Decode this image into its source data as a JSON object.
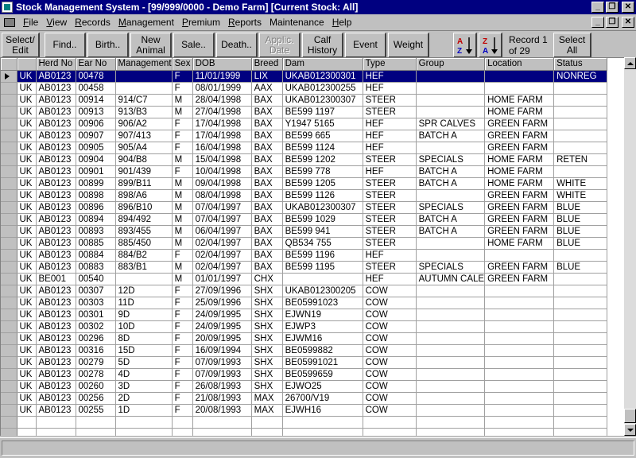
{
  "window": {
    "title": "Stock Management System - [99/999/0000 - Demo Farm] [Current Stock: All]"
  },
  "menu": [
    {
      "key": "F",
      "rest": "ile"
    },
    {
      "key": "V",
      "rest": "iew"
    },
    {
      "key": "R",
      "rest": "ecords"
    },
    {
      "key": "M",
      "rest": "anagement"
    },
    {
      "key": "P",
      "rest": "remium"
    },
    {
      "key": "R",
      "rest": "eports"
    },
    {
      "key": "",
      "rest": "Maintenance"
    },
    {
      "key": "H",
      "rest": "elp"
    }
  ],
  "toolbar": {
    "select_edit": "Select/\nEdit",
    "find": "Find..",
    "birth": "Birth..",
    "new_animal": "New\nAnimal",
    "sale": "Sale..",
    "death": "Death..",
    "applic_date": "Applic.\nDate",
    "calf_history": "Calf\nHistory",
    "event": "Event",
    "weight": "Weight",
    "record_info": "Record 1\nof 29",
    "select_all": "Select\nAll"
  },
  "grid": {
    "columns": [
      "",
      "Herd No",
      "Ear No",
      "Management",
      "Sex",
      "DOB",
      "Breed",
      "Dam",
      "Type",
      "Group",
      "Location",
      "Status"
    ],
    "rows": [
      [
        "UK",
        "AB0123",
        "00478",
        "",
        "F",
        "11/01/1999",
        "LIX",
        "UKAB012300301",
        "HEF",
        "",
        "",
        "NONREG"
      ],
      [
        "UK",
        "AB0123",
        "00458",
        "",
        "F",
        "08/01/1999",
        "AAX",
        "UKAB012300255",
        "HEF",
        "",
        "",
        ""
      ],
      [
        "UK",
        "AB0123",
        "00914",
        "914/C7",
        "M",
        "28/04/1998",
        "BAX",
        "UKAB012300307",
        "STEER",
        "",
        "HOME FARM",
        ""
      ],
      [
        "UK",
        "AB0123",
        "00913",
        "913/B3",
        "M",
        "27/04/1998",
        "BAX",
        "BE599 1197",
        "STEER",
        "",
        "HOME FARM",
        ""
      ],
      [
        "UK",
        "AB0123",
        "00906",
        "906/A2",
        "F",
        "17/04/1998",
        "BAX",
        "Y1947 5165",
        "HEF",
        "SPR CALVES",
        "GREEN FARM",
        ""
      ],
      [
        "UK",
        "AB0123",
        "00907",
        "907/413",
        "F",
        "17/04/1998",
        "BAX",
        "BE599 665",
        "HEF",
        "BATCH A",
        "GREEN FARM",
        ""
      ],
      [
        "UK",
        "AB0123",
        "00905",
        "905/A4",
        "F",
        "16/04/1998",
        "BAX",
        "BE599 1124",
        "HEF",
        "",
        "GREEN FARM",
        ""
      ],
      [
        "UK",
        "AB0123",
        "00904",
        "904/B8",
        "M",
        "15/04/1998",
        "BAX",
        "BE599 1202",
        "STEER",
        "SPECIALS",
        "HOME FARM",
        "RETEN"
      ],
      [
        "UK",
        "AB0123",
        "00901",
        "901/439",
        "F",
        "10/04/1998",
        "BAX",
        "BE599 778",
        "HEF",
        "BATCH A",
        "HOME FARM",
        ""
      ],
      [
        "UK",
        "AB0123",
        "00899",
        "899/B11",
        "M",
        "09/04/1998",
        "BAX",
        "BE599 1205",
        "STEER",
        "BATCH A",
        "HOME FARM",
        "WHITE"
      ],
      [
        "UK",
        "AB0123",
        "00898",
        "898/A6",
        "M",
        "08/04/1998",
        "BAX",
        "BE599 1126",
        "STEER",
        "",
        "GREEN FARM",
        "WHITE"
      ],
      [
        "UK",
        "AB0123",
        "00896",
        "896/B10",
        "M",
        "07/04/1997",
        "BAX",
        "UKAB012300307",
        "STEER",
        "SPECIALS",
        "GREEN FARM",
        "BLUE"
      ],
      [
        "UK",
        "AB0123",
        "00894",
        "894/492",
        "M",
        "07/04/1997",
        "BAX",
        "BE599 1029",
        "STEER",
        "BATCH A",
        "GREEN FARM",
        "BLUE"
      ],
      [
        "UK",
        "AB0123",
        "00893",
        "893/455",
        "M",
        "06/04/1997",
        "BAX",
        "BE599 941",
        "STEER",
        "BATCH A",
        "GREEN FARM",
        "BLUE"
      ],
      [
        "UK",
        "AB0123",
        "00885",
        "885/450",
        "M",
        "02/04/1997",
        "BAX",
        "QB534 755",
        "STEER",
        "",
        "HOME FARM",
        "BLUE"
      ],
      [
        "UK",
        "AB0123",
        "00884",
        "884/B2",
        "F",
        "02/04/1997",
        "BAX",
        "BE599 1196",
        "HEF",
        "",
        "",
        ""
      ],
      [
        "UK",
        "AB0123",
        "00883",
        "883/B1",
        "M",
        "02/04/1997",
        "BAX",
        "BE599 1195",
        "STEER",
        "SPECIALS",
        "GREEN FARM",
        "BLUE"
      ],
      [
        "UK",
        "BE001",
        "00540",
        "",
        "M",
        "01/01/1997",
        "CHX",
        "",
        "HEF",
        "AUTUMN CALE",
        "GREEN FARM",
        ""
      ],
      [
        "UK",
        "AB0123",
        "00307",
        "12D",
        "F",
        "27/09/1996",
        "SHX",
        "UKAB012300205",
        "COW",
        "",
        "",
        ""
      ],
      [
        "UK",
        "AB0123",
        "00303",
        "11D",
        "F",
        "25/09/1996",
        "SHX",
        "BE05991023",
        "COW",
        "",
        "",
        ""
      ],
      [
        "UK",
        "AB0123",
        "00301",
        "9D",
        "F",
        "24/09/1995",
        "SHX",
        "EJWN19",
        "COW",
        "",
        "",
        ""
      ],
      [
        "UK",
        "AB0123",
        "00302",
        "10D",
        "F",
        "24/09/1995",
        "SHX",
        "EJWP3",
        "COW",
        "",
        "",
        ""
      ],
      [
        "UK",
        "AB0123",
        "00296",
        "8D",
        "F",
        "20/09/1995",
        "SHX",
        "EJWM16",
        "COW",
        "",
        "",
        ""
      ],
      [
        "UK",
        "AB0123",
        "00316",
        "15D",
        "F",
        "16/09/1994",
        "SHX",
        "BE0599882",
        "COW",
        "",
        "",
        ""
      ],
      [
        "UK",
        "AB0123",
        "00279",
        "5D",
        "F",
        "07/09/1993",
        "SHX",
        "BE05991021",
        "COW",
        "",
        "",
        ""
      ],
      [
        "UK",
        "AB0123",
        "00278",
        "4D",
        "F",
        "07/09/1993",
        "SHX",
        "BE0599659",
        "COW",
        "",
        "",
        ""
      ],
      [
        "UK",
        "AB0123",
        "00260",
        "3D",
        "F",
        "26/08/1993",
        "SHX",
        "EJWO25",
        "COW",
        "",
        "",
        ""
      ],
      [
        "UK",
        "AB0123",
        "00256",
        "2D",
        "F",
        "21/08/1993",
        "MAX",
        "26700/V19",
        "COW",
        "",
        "",
        ""
      ],
      [
        "UK",
        "AB0123",
        "00255",
        "1D",
        "F",
        "20/08/1993",
        "MAX",
        "EJWH16",
        "COW",
        "",
        "",
        ""
      ]
    ]
  },
  "colors": {
    "title_bg": "#000080",
    "selection_bg": "#000080",
    "chrome": "#c0c0c0",
    "sort_a_red": "#c00000",
    "sort_z_blue": "#0000c0"
  }
}
